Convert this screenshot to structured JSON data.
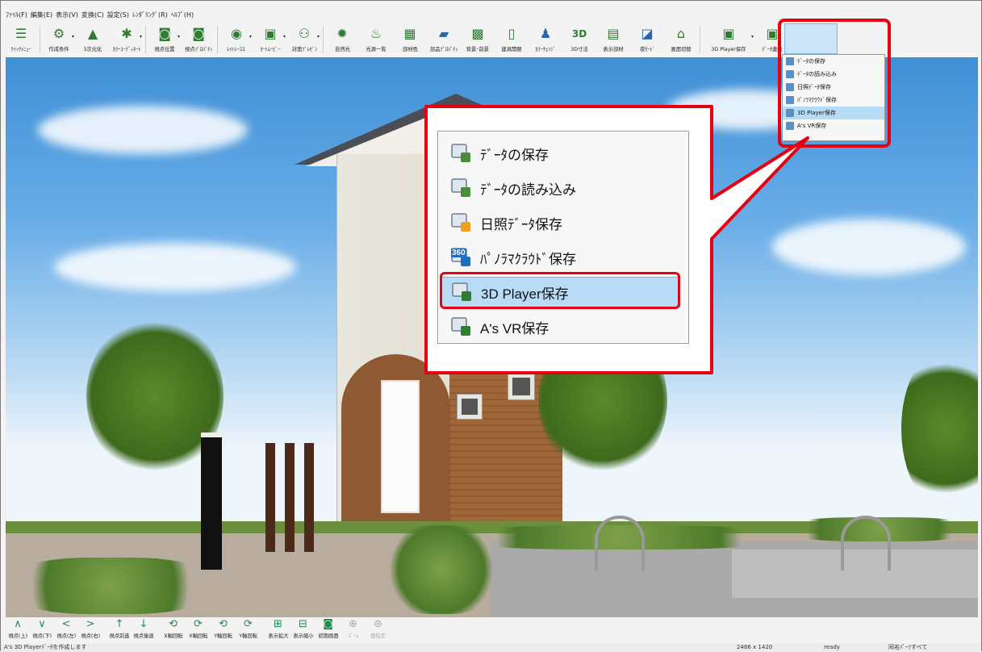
{
  "menubar": [
    "ﾌｧｲﾙ(F)",
    "編集(E)",
    "表示(V)",
    "変換(C)",
    "設定(S)",
    "ﾚﾝﾀﾞﾘﾝｸﾞ(R)",
    "ﾍﾙﾌﾟ(H)"
  ],
  "toolbar": [
    {
      "label": "ｸｲｯｸﾒﾆｭｰ",
      "icon": "hamburger-icon",
      "glyph": "☰"
    },
    {
      "label": "作成条件",
      "icon": "conditions-icon",
      "glyph": "⚙",
      "dd": true
    },
    {
      "label": "3次元化",
      "icon": "3d-convert-icon",
      "glyph": "▲"
    },
    {
      "label": "ｶﾗｰｺｰﾃﾞｨﾈｰﾄ",
      "icon": "color-coordinate-icon",
      "glyph": "✱",
      "dd": true
    },
    {
      "label": "視点位置",
      "icon": "camera-icon",
      "glyph": "◙",
      "dd": true
    },
    {
      "label": "視点ﾌﾟﾛﾊﾟﾃｨ",
      "icon": "camera-property-icon",
      "glyph": "◙"
    },
    {
      "label": "ﾚｲﾄﾚｰｽ1",
      "icon": "raytrace-icon",
      "glyph": "◉",
      "dd": true
    },
    {
      "label": "ｵｰﾄﾑｰﾋﾞｰ",
      "icon": "auto-movie-icon",
      "glyph": "▣",
      "dd": true
    },
    {
      "label": "対面ﾌﾟﾚｾﾞﾝ",
      "icon": "presentation-icon",
      "glyph": "⚇",
      "dd": true
    },
    {
      "label": "自然光",
      "icon": "sunlight-icon",
      "glyph": "✹"
    },
    {
      "label": "光源一覧",
      "icon": "light-source-icon",
      "glyph": "♨"
    },
    {
      "label": "部材色",
      "icon": "material-color-icon",
      "glyph": "▦"
    },
    {
      "label": "部品ﾌﾟﾛﾊﾟﾃｨ",
      "icon": "part-property-icon",
      "glyph": "▰"
    },
    {
      "label": "背景･前景",
      "icon": "background-icon",
      "glyph": "▩"
    },
    {
      "label": "建具開閉",
      "icon": "fitting-open-icon",
      "glyph": "▯"
    },
    {
      "label": "ｶﾗｰﾁｪﾝｼﾞ",
      "icon": "color-change-icon",
      "glyph": "♟"
    },
    {
      "label": "3D寸法",
      "icon": "3d-dimension-icon",
      "glyph": "3D"
    },
    {
      "label": "表示部材",
      "icon": "display-member-icon",
      "glyph": "▤"
    },
    {
      "label": "夜ﾓｰﾄﾞ",
      "icon": "night-mode-icon",
      "glyph": "◪"
    },
    {
      "label": "画面切替",
      "icon": "screen-switch-icon",
      "glyph": "⌂"
    },
    {
      "label": "3D Player保存",
      "icon": "3d-player-save-icon",
      "glyph": "▣",
      "dd": true
    },
    {
      "label": "ﾃﾞｰﾀ連携",
      "icon": "data-link-icon",
      "glyph": "▣",
      "dd": true
    }
  ],
  "small_menu": [
    {
      "label": "ﾃﾞｰﾀの保存",
      "icon": "data-save-icon"
    },
    {
      "label": "ﾃﾞｰﾀの読み込み",
      "icon": "data-load-icon"
    },
    {
      "label": "日照ﾃﾞｰﾀ保存",
      "icon": "sunlight-data-save-icon"
    },
    {
      "label": "ﾊﾟﾉﾗﾏｸﾗｳﾄﾞ保存",
      "icon": "panorama-cloud-save-icon"
    },
    {
      "label": "3D Player保存",
      "icon": "3d-player-save-icon",
      "selected": true
    },
    {
      "label": "A's VR保存",
      "icon": "as-vr-save-icon"
    }
  ],
  "big_menu": [
    {
      "label": "ﾃﾞｰﾀの保存",
      "icon": "data-save-icon"
    },
    {
      "label": "ﾃﾞｰﾀの読み込み",
      "icon": "data-load-icon"
    },
    {
      "label": "日照ﾃﾞｰﾀ保存",
      "icon": "sunlight-data-save-icon"
    },
    {
      "label": "ﾊﾟﾉﾗﾏｸﾗｳﾄﾞ保存",
      "icon": "panorama-cloud-save-icon",
      "badge": "360"
    },
    {
      "label": "3D Player保存",
      "icon": "3d-player-save-icon",
      "selected": true
    },
    {
      "label": "A's VR保存",
      "icon": "as-vr-save-icon"
    }
  ],
  "bottombar": [
    {
      "label": "視点(上)",
      "glyph": "∧"
    },
    {
      "label": "視点(下)",
      "glyph": "∨"
    },
    {
      "label": "視点(左)",
      "glyph": "<"
    },
    {
      "label": "視点(右)",
      "glyph": ">"
    },
    {
      "label": "視点前進",
      "glyph": "↑"
    },
    {
      "label": "視点後退",
      "glyph": "↓"
    },
    {
      "label": "X軸回転",
      "glyph": "⟲"
    },
    {
      "label": "X軸回転",
      "glyph": "⟳"
    },
    {
      "label": "Y軸回転",
      "glyph": "⟲"
    },
    {
      "label": "Y軸回転",
      "glyph": "⟳"
    },
    {
      "label": "表示拡大",
      "glyph": "⊞"
    },
    {
      "label": "表示縮小",
      "glyph": "⊟"
    },
    {
      "label": "初期画面",
      "glyph": "◙"
    },
    {
      "label": "ｽﾞｰﾑ",
      "glyph": "⊕",
      "disabled": true
    },
    {
      "label": "面指定",
      "glyph": "⊛",
      "disabled": true
    }
  ],
  "status": {
    "message": "A's 3D Playerﾃﾞｰﾀを作成します",
    "size": "2486 x 1420",
    "state": "ready",
    "mode": "同名ﾊﾟｰﾂすべて"
  },
  "colors": {
    "highlight": "#e60012",
    "selection": "#b8dcf6",
    "icon_green": "#2e7d32"
  }
}
